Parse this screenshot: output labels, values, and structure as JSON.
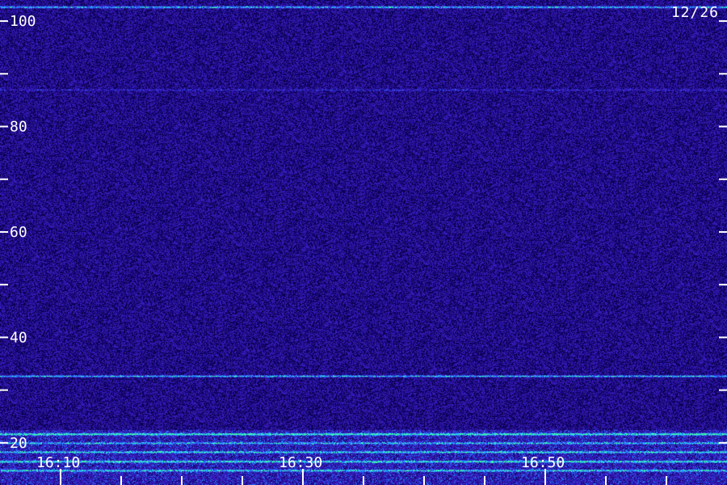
{
  "date_label": "12/26",
  "colors": {
    "background": "#2a0a6e",
    "band": "#3a5cff",
    "hot": "#40ffb0",
    "tick": "#ffffff"
  },
  "chart_data": {
    "type": "heatmap",
    "title": "",
    "xlabel": "",
    "ylabel": "",
    "y_ticks": [
      {
        "value": 20,
        "label": "20"
      },
      {
        "value": 30,
        "label": ""
      },
      {
        "value": 40,
        "label": "40"
      },
      {
        "value": 50,
        "label": ""
      },
      {
        "value": 60,
        "label": "60"
      },
      {
        "value": 70,
        "label": ""
      },
      {
        "value": 80,
        "label": "80"
      },
      {
        "value": 90,
        "label": ""
      },
      {
        "value": 100,
        "label": "100"
      }
    ],
    "ylim": [
      12,
      104
    ],
    "x_ticks": [
      {
        "label": "16:10",
        "major": true
      },
      {
        "label": "",
        "major": false
      },
      {
        "label": "",
        "major": false
      },
      {
        "label": "",
        "major": false
      },
      {
        "label": "16:30",
        "major": true
      },
      {
        "label": "",
        "major": false
      },
      {
        "label": "",
        "major": false
      },
      {
        "label": "",
        "major": false
      },
      {
        "label": "16:50",
        "major": true
      },
      {
        "label": "",
        "major": false
      },
      {
        "label": "",
        "major": false
      }
    ],
    "lines": [
      {
        "y": 102.7,
        "intensity": 0.8
      },
      {
        "y": 87,
        "intensity": 0.25
      },
      {
        "y": 32.7,
        "intensity": 0.75
      },
      {
        "y": 21.7,
        "intensity": 0.9
      },
      {
        "y": 20.0,
        "intensity": 0.6
      },
      {
        "y": 18.3,
        "intensity": 0.7
      },
      {
        "y": 16.5,
        "intensity": 0.8
      },
      {
        "y": 14.8,
        "intensity": 0.7
      }
    ]
  }
}
